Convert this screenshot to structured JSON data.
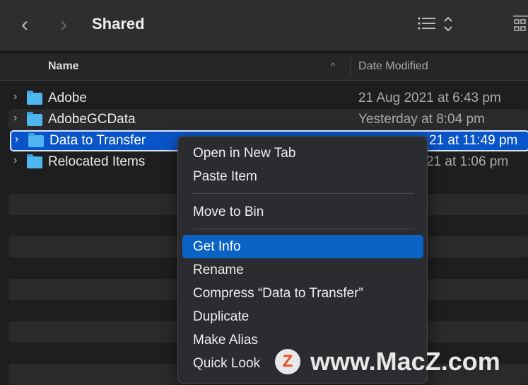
{
  "toolbar": {
    "title": "Shared",
    "back": "‹",
    "forward": "›",
    "list_view_icon": "list-icon",
    "sort_icon": "chevron-updown-icon",
    "grid_icon": "grid-icon"
  },
  "header": {
    "name": "Name",
    "sort_indicator": "^",
    "date_modified": "Date Modified"
  },
  "rows": [
    {
      "name": "Adobe",
      "date": "21 Aug 2021 at 6:43 pm"
    },
    {
      "name": "AdobeGCData",
      "date": "Yesterday at 8:04 pm"
    },
    {
      "name": "Data to Transfer",
      "date": "21 at 11:49 pm",
      "selected": true
    },
    {
      "name": "Relocated Items",
      "date": "21 at 1:06 pm"
    }
  ],
  "context_menu": {
    "items": [
      "Open in New Tab",
      "Paste Item",
      "Move to Bin",
      "Get Info",
      "Rename",
      "Compress “Data to Transfer”",
      "Duplicate",
      "Make Alias",
      "Quick Look"
    ],
    "highlighted": "Get Info"
  },
  "watermark": {
    "logo": "Z",
    "text": "www.MacZ.com"
  },
  "colors": {
    "selection": "#0a54c9",
    "menu_highlight": "#0b63c4",
    "folder": "#4fb7ef"
  }
}
